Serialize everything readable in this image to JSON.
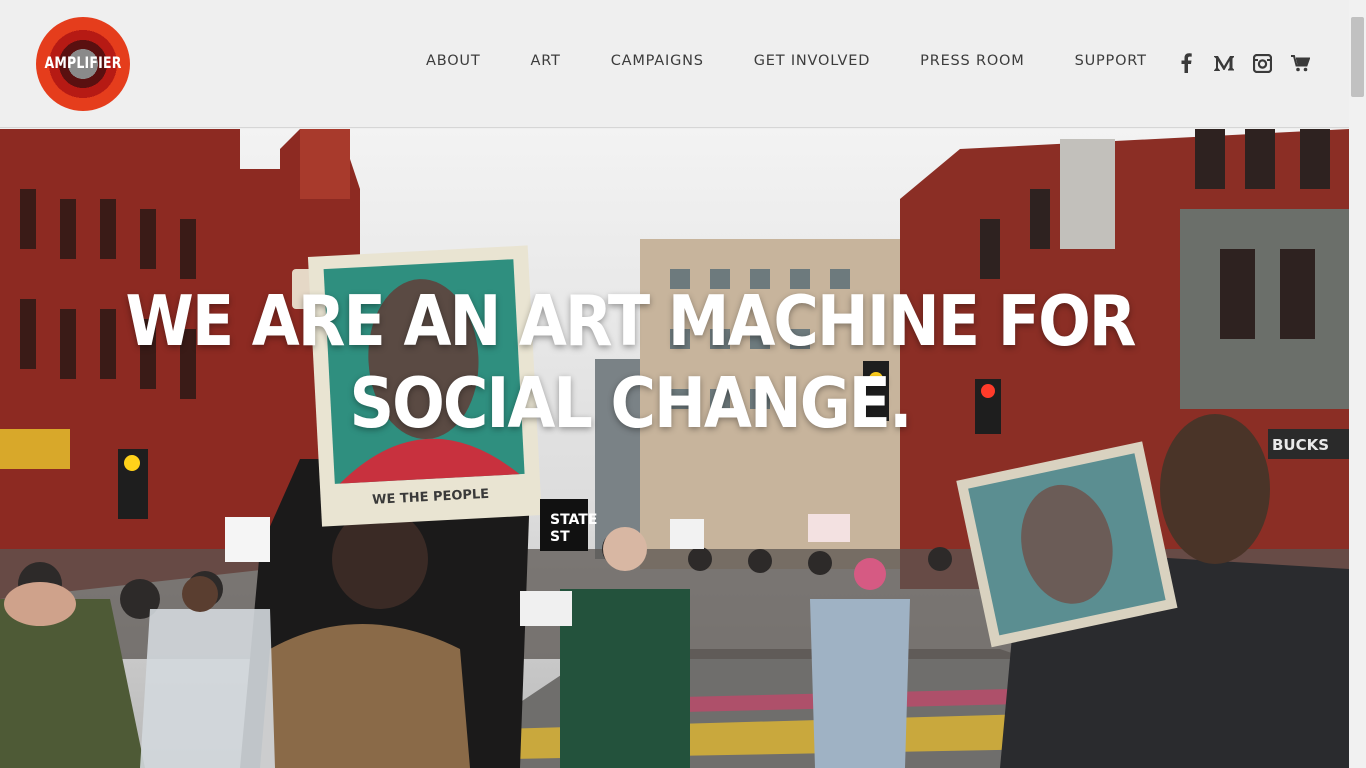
{
  "brand": {
    "logo_text": "AMPLIFIER"
  },
  "nav": {
    "items": [
      "ABOUT",
      "ART",
      "CAMPAIGNS",
      "GET INVOLVED",
      "PRESS ROOM",
      "SUPPORT"
    ]
  },
  "social": {
    "icons": [
      "facebook-icon",
      "medium-icon",
      "instagram-icon",
      "cart-icon"
    ]
  },
  "hero": {
    "headline": "WE ARE AN ART MACHINE FOR SOCIAL CHANGE.",
    "poster_text": "WE THE PEOPLE",
    "sign_text": "STATE\nST",
    "storefront_text": "BUCKS"
  },
  "colors": {
    "header_bg": "#efefef",
    "nav_text": "#3c3c3c",
    "logo_orange": "#e53d1c",
    "logo_red": "#b61a14",
    "brick": "#8d2a22"
  }
}
